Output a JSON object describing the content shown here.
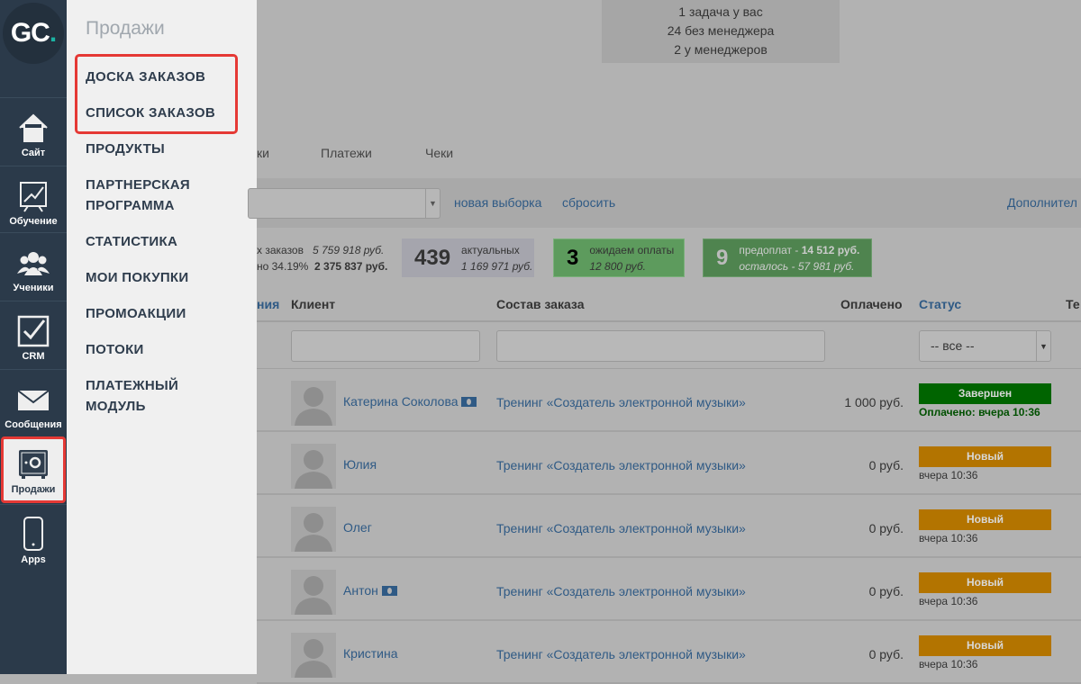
{
  "sidebar": {
    "logo": "GC",
    "logo_dot": ".",
    "items": [
      {
        "label": "Сайт",
        "icon": "home-icon"
      },
      {
        "label": "Обучение",
        "icon": "chart-icon"
      },
      {
        "label": "Ученики",
        "icon": "users-icon"
      },
      {
        "label": "CRM",
        "icon": "checkbox-icon"
      },
      {
        "label": "Сообщения",
        "icon": "envelope-icon"
      },
      {
        "label": "Продажи",
        "icon": "safe-icon",
        "active": true
      },
      {
        "label": "Apps",
        "icon": "phone-icon"
      }
    ]
  },
  "menu": {
    "title": "Продажи",
    "items": [
      "ДОСКА ЗАКАЗОВ",
      "СПИСОК ЗАКАЗОВ",
      "ПРОДУКТЫ",
      "ПАРТНЕРСКАЯ ПРОГРАММА",
      "СТАТИСТИКА",
      "МОИ ПОКУПКИ",
      "ПРОМОАКЦИИ",
      "ПОТОКИ",
      "ПЛАТЕЖНЫЙ МОДУЛЬ"
    ],
    "highlight_color": "#e53935"
  },
  "top": {
    "lines": [
      "1 задача у вас",
      "24 без менеджера",
      "2 у менеджеров"
    ]
  },
  "tabs": [
    "ки",
    "Платежи",
    "Чеки"
  ],
  "filter": {
    "new_selection": "новая выборка",
    "reset": "сбросить",
    "more": "Дополнител"
  },
  "stats": {
    "total_label": "х заказов",
    "total_value": "5 759 918 руб.",
    "paid_label": "но 34.19%",
    "paid_value": "2 375 837 руб.",
    "actual": {
      "num": "439",
      "label": "актуальных",
      "value": "1 169 971 руб."
    },
    "waiting": {
      "num": "3",
      "label": "ожидаем оплаты",
      "value": "12 800 руб."
    },
    "prepaid": {
      "num": "9",
      "label": "предоплат - ",
      "label_value": "14 512 руб.",
      "rest": "осталось - 57 981 руб."
    }
  },
  "table": {
    "headers": [
      "ния",
      "Клиент",
      "Состав заказа",
      "Оплачено",
      "Статус",
      "Те"
    ],
    "status_filter": "-- все --",
    "rows": [
      {
        "client": "Катерина Соколова",
        "money": true,
        "product": "Тренинг «Создатель электронной музыки»",
        "paid": "1 000 руб.",
        "status": "Завершен",
        "status_color": "#006400",
        "sub": "Оплачено: вчера 10:36"
      },
      {
        "client": "Юлия",
        "money": false,
        "product": "Тренинг «Создатель электронной музыки»",
        "paid": "0 руб.",
        "status": "Новый",
        "status_color": "#b37400",
        "sub": "вчера 10:36"
      },
      {
        "client": "Олег",
        "money": false,
        "product": "Тренинг «Создатель электронной музыки»",
        "paid": "0 руб.",
        "status": "Новый",
        "status_color": "#b37400",
        "sub": "вчера 10:36"
      },
      {
        "client": "Антон",
        "money": true,
        "product": "Тренинг «Создатель электронной музыки»",
        "paid": "0 руб.",
        "status": "Новый",
        "status_color": "#b37400",
        "sub": "вчера 10:36"
      },
      {
        "client": "Кристина",
        "money": false,
        "product": "Тренинг «Создатель электронной музыки»",
        "paid": "0 руб.",
        "status": "Новый",
        "status_color": "#b37400",
        "sub": "вчера 10:36"
      }
    ]
  }
}
